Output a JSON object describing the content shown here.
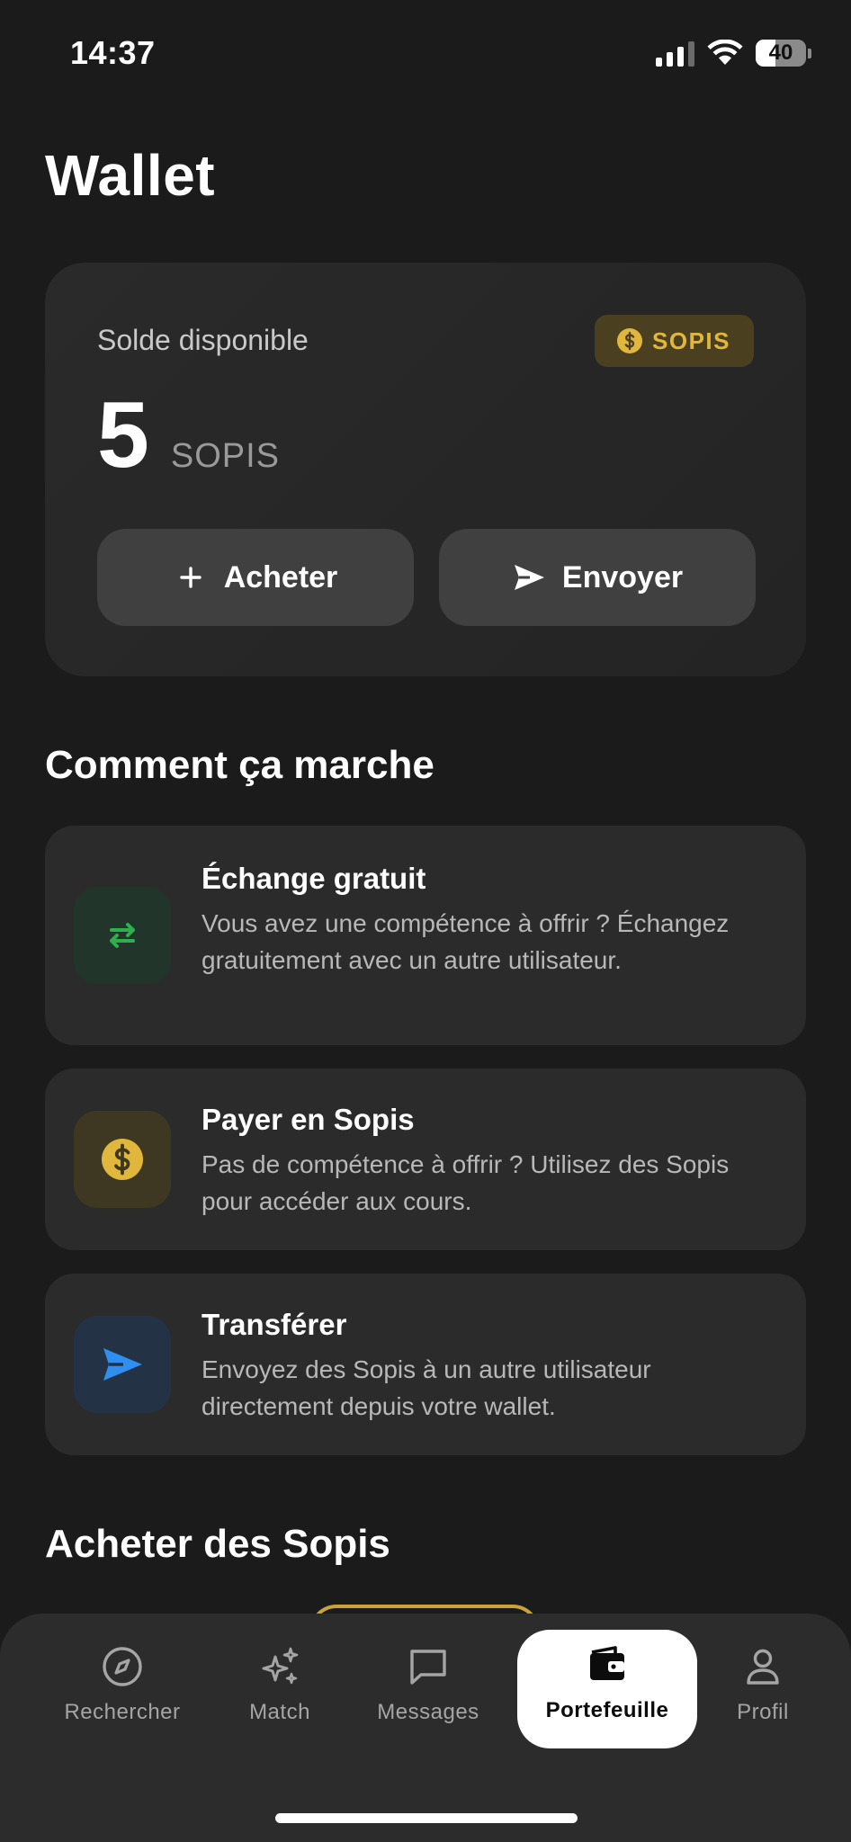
{
  "status_bar": {
    "time": "14:37",
    "battery_level": "40",
    "battery_fraction": 0.4
  },
  "page_title": "Wallet",
  "balance_card": {
    "label": "Solde disponible",
    "badge_label": "SOPIS",
    "badge_icon": "dollar-coin-icon",
    "amount": "5",
    "unit": "SOPIS",
    "buy_label": "Acheter",
    "send_label": "Envoyer"
  },
  "how_it_works": {
    "title": "Comment ça marche",
    "items": [
      {
        "title": "Échange gratuit",
        "description": "Vous avez une compétence à offrir ? Échangez gratuitement avec un autre utilisateur.",
        "icon": "swap-arrows-icon"
      },
      {
        "title": "Payer en Sopis",
        "description": "Pas de compétence à offrir ? Utilisez des Sopis pour accéder aux cours.",
        "icon": "dollar-coin-icon"
      },
      {
        "title": "Transférer",
        "description": "Envoyez des Sopis à un autre utilisateur directement depuis votre wallet.",
        "icon": "send-icon"
      }
    ]
  },
  "buy_section": {
    "title": "Acheter des Sopis"
  },
  "colors": {
    "accent_gold": "#e0b73c",
    "accent_green": "#2fae4e",
    "accent_blue": "#2f8ff0",
    "background": "#1b1b1b"
  },
  "bottom_nav": {
    "items": [
      {
        "label": "Rechercher",
        "icon": "compass-icon"
      },
      {
        "label": "Match",
        "icon": "sparkles-icon"
      },
      {
        "label": "Messages",
        "icon": "message-icon"
      },
      {
        "label": "Portefeuille",
        "icon": "wallet-icon",
        "active": true
      },
      {
        "label": "Profil",
        "icon": "person-icon"
      }
    ]
  }
}
